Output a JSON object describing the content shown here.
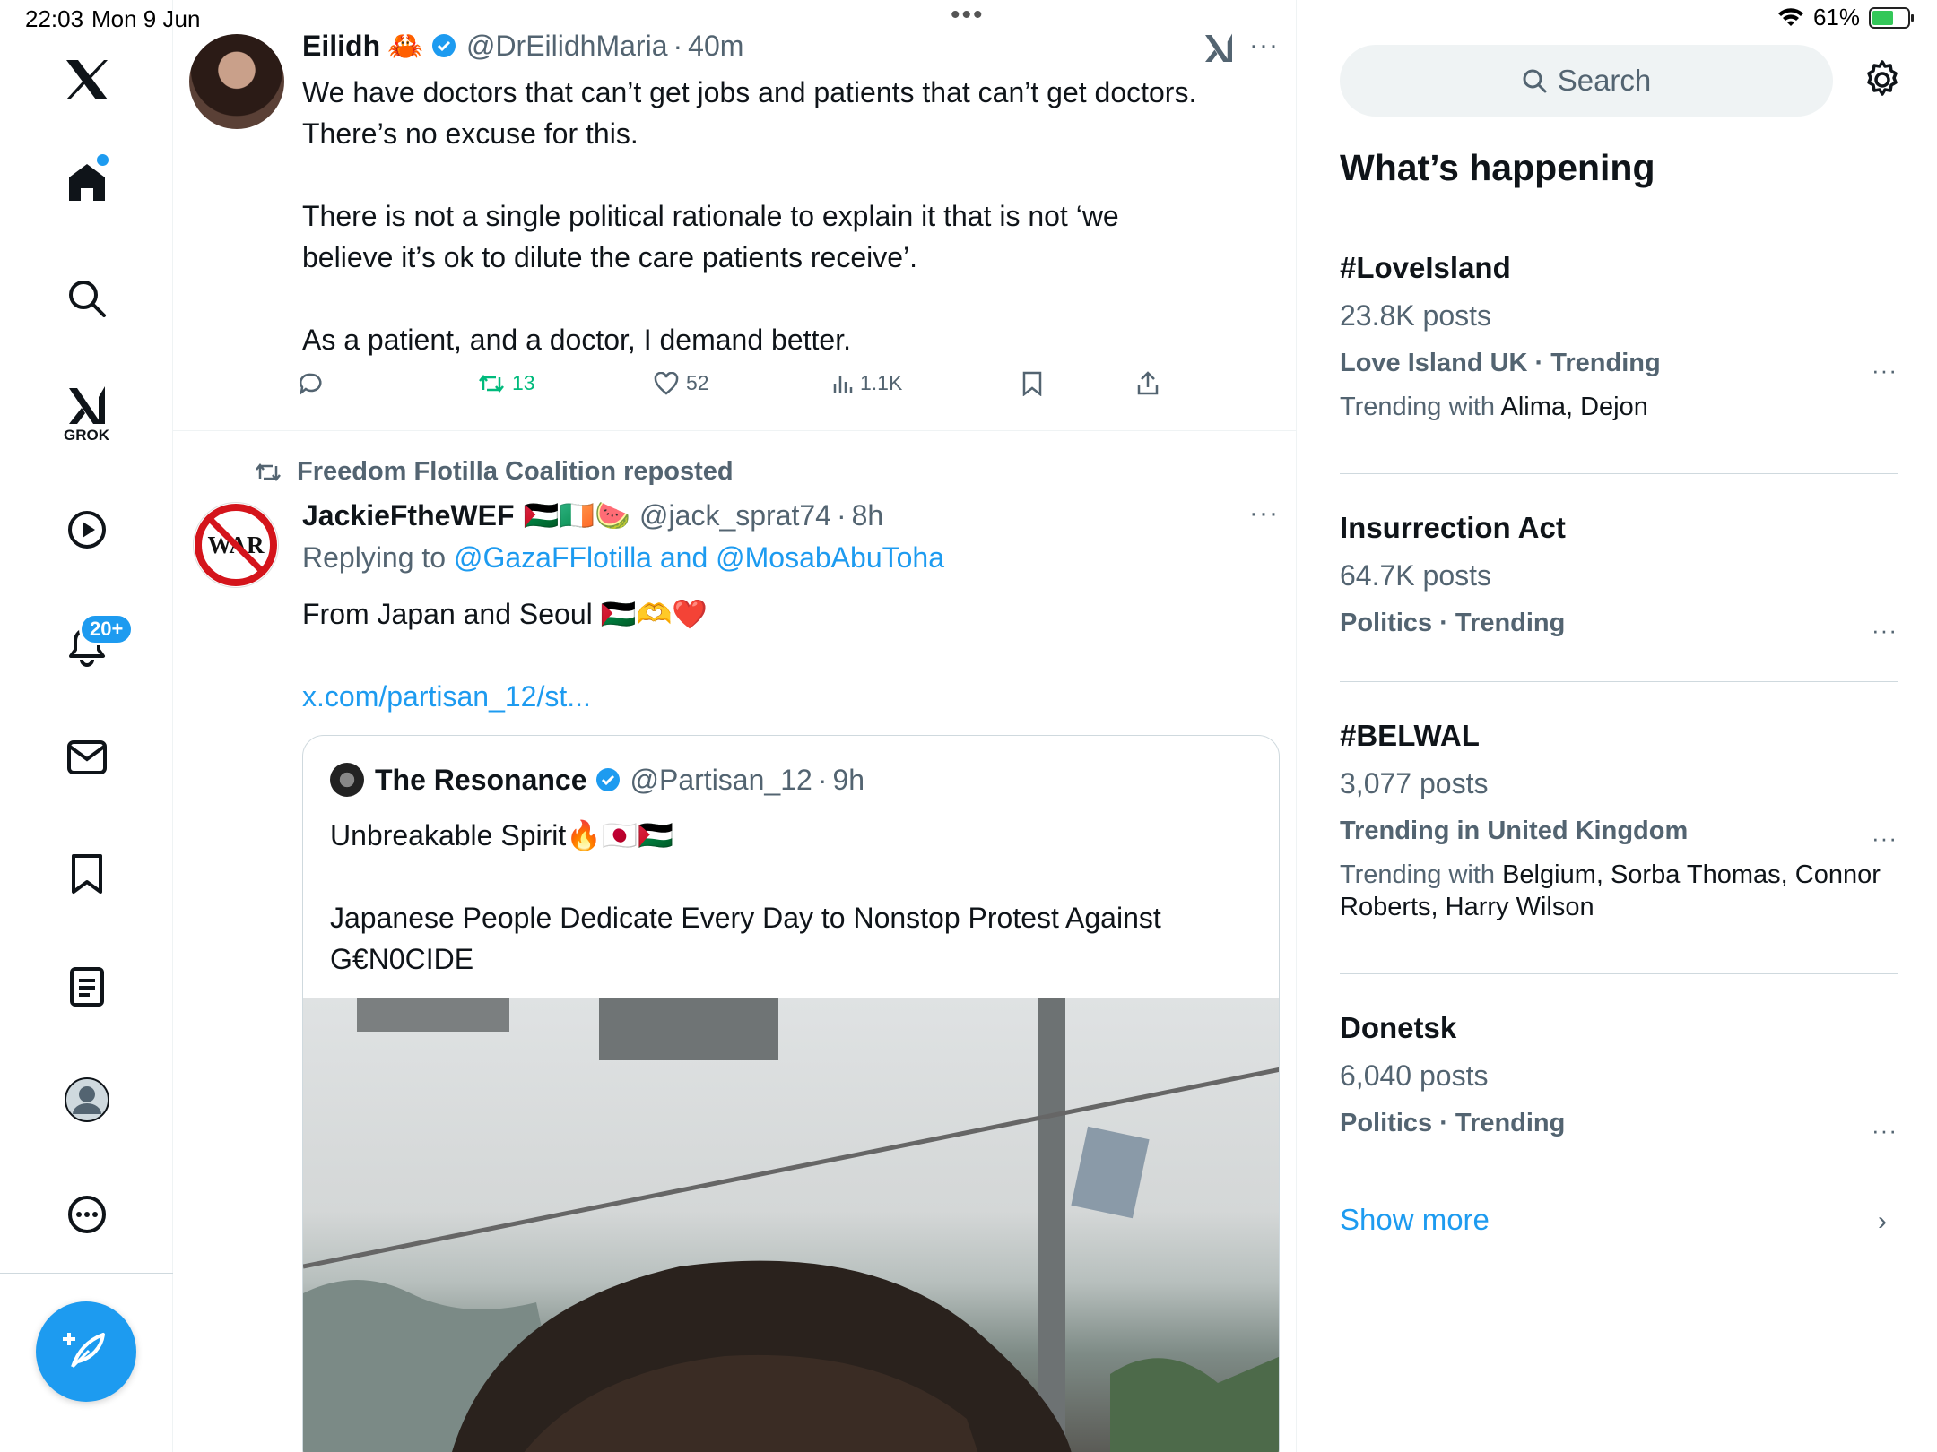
{
  "status_bar": {
    "time": "22:03",
    "date": "Mon 9 Jun",
    "battery": "61%",
    "battery_level": 0.61
  },
  "nav": {
    "grok_label": "GROK",
    "notifications_badge": "20+",
    "items": [
      "x-logo",
      "home-icon",
      "search-icon",
      "grok-icon",
      "video-icon",
      "bell-icon",
      "mail-icon",
      "bookmark-icon",
      "list-icon",
      "profile-icon",
      "more-icon"
    ]
  },
  "tweet1": {
    "name": "Eilidh",
    "name_emoji": "🦀",
    "handle": "@DrEilidhMaria",
    "sep": "·",
    "time": "40m",
    "text": "We have doctors that can’t get jobs and patients that can’t get doctors.\nThere’s no excuse for this.\n\nThere is not a single political rationale to explain it that is not ‘we\nbelieve it’s ok to dilute the care patients receive’.\n\nAs a patient, and a doctor, I demand better.",
    "retweets": "13",
    "likes": "52",
    "views": "1.1K"
  },
  "tweet2": {
    "repost_by": "Freedom Flotilla Coalition reposted",
    "name": "JackieFtheWEF",
    "name_emoji": "🇵🇸🇮🇪🍉",
    "handle": "@jack_sprat74",
    "sep": "·",
    "time": "8h",
    "avatar_text": "WAR",
    "replying_prefix": "Replying to",
    "replying_to": "@GazaFFlotilla and @MosabAbuToha",
    "text": "From Japan and Seoul 🇵🇸🫶❤️",
    "link": "x.com/partisan_12/st..."
  },
  "quote": {
    "name": "The Resonance",
    "handle": "@Partisan_12",
    "sep": "·",
    "time": "9h",
    "text": "Unbreakable Spirit🔥🇯🇵🇵🇸\n\nJapanese People Dedicate Every Day to Nonstop Protest Against\nG€N0CIDE"
  },
  "sidebar": {
    "search_placeholder": "Search",
    "section_title": "What’s happening",
    "trends": [
      {
        "name": "#LoveIsland",
        "posts": "23.8K posts",
        "meta": "Love Island UK · Trending",
        "with_prefix": "Trending with",
        "with": "Alima, Dejon"
      },
      {
        "name": "Insurrection Act",
        "posts": "64.7K posts",
        "meta": "Politics · Trending",
        "with_prefix": "",
        "with": ""
      },
      {
        "name": "#BELWAL",
        "posts": "3,077 posts",
        "meta": "Trending in United Kingdom",
        "with_prefix": "Trending with",
        "with": "Belgium, Sorba Thomas, Connor\nRoberts, Harry Wilson"
      },
      {
        "name": "Donetsk",
        "posts": "6,040 posts",
        "meta": "Politics · Trending",
        "with_prefix": "",
        "with": ""
      }
    ],
    "show_more": "Show more"
  },
  "colors": {
    "accent": "#1d9bf0",
    "retweet": "#00ba7c",
    "muted": "#536471",
    "text": "#0f1419"
  }
}
